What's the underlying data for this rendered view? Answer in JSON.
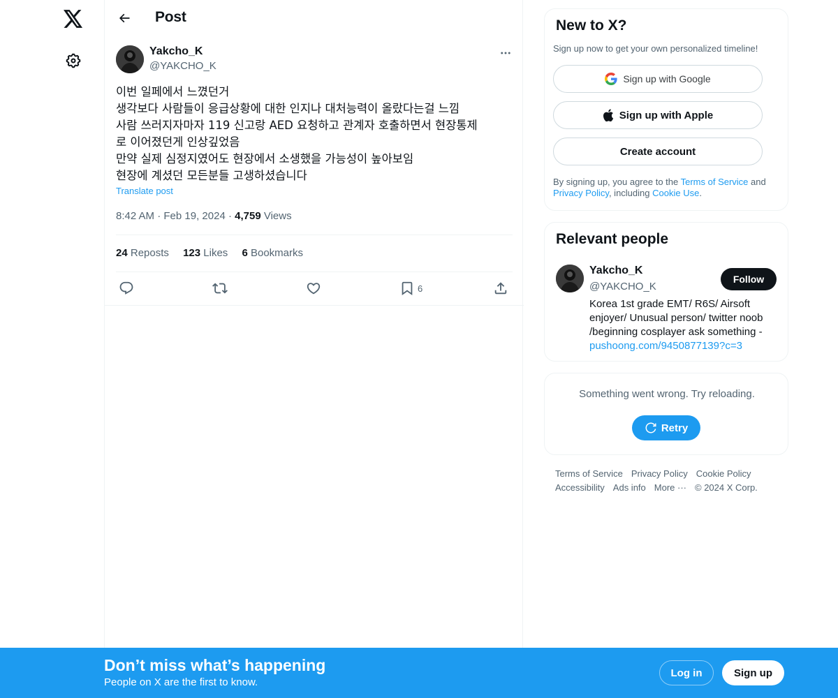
{
  "header": {
    "title": "Post"
  },
  "post": {
    "author_name": "Yakcho_K",
    "author_handle": "@YAKCHO_K",
    "lines": [
      "이번 일페에서 느꼈던거",
      "생각보다 사람들이 응급상황에 대한 인지나 대처능력이 올랐다는걸 느낌",
      "사람 쓰러지자마자 119 신고랑 AED 요청하고 관계자 호출하면서 현장통제",
      "로 이어졌던게 인상깊었음",
      "만약 실제 심정지였어도 현장에서 소생했을 가능성이 높아보임",
      "현장에 계셨던 모든분들 고생하셨습니다"
    ],
    "translate_label": "Translate post",
    "time": "8:42 AM",
    "date": "Feb 19, 2024",
    "views_count": "4,759",
    "views_label": "Views",
    "reposts_count": "24",
    "reposts_label": "Reposts",
    "likes_count": "123",
    "likes_label": "Likes",
    "bookmarks_count": "6",
    "bookmarks_label": "Bookmarks",
    "bookmark_action_count": "6"
  },
  "signup": {
    "title": "New to X?",
    "subtitle": "Sign up now to get your own personalized timeline!",
    "google_label": "Sign up with Google",
    "apple_label": "Sign up with Apple",
    "create_label": "Create account",
    "legal_prefix": "By signing up, you agree to the ",
    "terms_link": "Terms of Service",
    "legal_and": " and ",
    "privacy_link": "Privacy Policy",
    "legal_including": ", including ",
    "cookie_link": "Cookie Use",
    "legal_end": "."
  },
  "relevant": {
    "title": "Relevant people",
    "name": "Yakcho_K",
    "handle": "@YAKCHO_K",
    "follow_label": "Follow",
    "bio": "Korea 1st grade EMT/ R6S/ Airsoft enjoyer/ Unusual person/ twitter noob /beginning cosplayer ask something -",
    "bio_link": "pushoong.com/9450877139?c=3"
  },
  "trends_error": {
    "message": "Something went wrong. Try reloading.",
    "retry_label": "Retry"
  },
  "footer": {
    "terms": "Terms of Service",
    "privacy": "Privacy Policy",
    "cookie": "Cookie Policy",
    "accessibility": "Accessibility",
    "ads": "Ads info",
    "more": "More ···",
    "copyright": "© 2024 X Corp."
  },
  "banner": {
    "title": "Don’t miss what’s happening",
    "subtitle": "People on X are the first to know.",
    "login_label": "Log in",
    "signup_label": "Sign up"
  },
  "colors": {
    "accent": "#1d9bf0",
    "text": "#0f1419",
    "muted": "#536471",
    "border": "#eff3f4"
  },
  "icons": {
    "logo": "x-logo-icon",
    "settings": "gear-icon",
    "back": "arrow-left-icon",
    "more": "ellipsis-icon",
    "reply": "reply-icon",
    "repost": "repost-icon",
    "like": "heart-icon",
    "bookmark": "bookmark-icon",
    "share": "share-icon",
    "google": "google-icon",
    "apple": "apple-icon",
    "retry": "refresh-icon"
  }
}
